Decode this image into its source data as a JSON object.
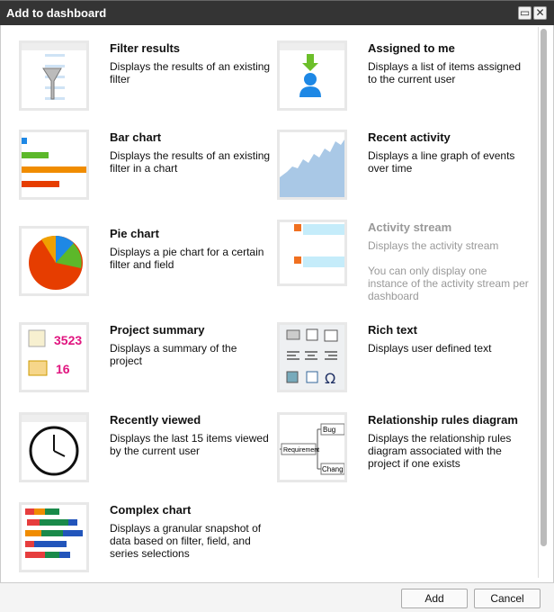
{
  "dialog": {
    "title": "Add to dashboard",
    "maximize_icon": "maximize-icon",
    "close_icon": "close-icon"
  },
  "items": [
    {
      "name": "Filter results",
      "desc": "Displays the results of an existing filter",
      "icon": "funnel-icon"
    },
    {
      "name": "Assigned to me",
      "desc": "Displays a list of items assigned to the current user",
      "icon": "user-assign-icon"
    },
    {
      "name": "Bar chart",
      "desc": "Displays the results of an existing filter in a chart",
      "icon": "bar-chart-icon"
    },
    {
      "name": "Recent activity",
      "desc": "Displays a line graph of events over time",
      "icon": "line-graph-icon"
    },
    {
      "name": "Pie chart",
      "desc": "Displays a pie chart for a certain filter and field",
      "icon": "pie-chart-icon"
    },
    {
      "name": "Activity stream",
      "desc": "Displays the activity stream",
      "note": "You can only display one instance of the activity stream per dashboard",
      "icon": "activity-stream-icon",
      "disabled": true
    },
    {
      "name": "Project summary",
      "desc": "Displays a summary of the project",
      "icon": "project-summary-icon",
      "stats": [
        "3523",
        "16"
      ]
    },
    {
      "name": "Rich text",
      "desc": "Displays user defined text",
      "icon": "rich-text-icon"
    },
    {
      "name": "Recently viewed",
      "desc": "Displays the last 15 items viewed by the current user",
      "icon": "clock-icon"
    },
    {
      "name": "Relationship rules diagram",
      "desc": "Displays the relationship rules diagram associated with the project if one exists",
      "icon": "diagram-icon",
      "diagram_labels": [
        "Requirement",
        "Bug",
        "Chang"
      ]
    },
    {
      "name": "Complex chart",
      "desc": "Displays a granular snapshot of data based on filter, field, and series selections",
      "icon": "complex-chart-icon"
    }
  ],
  "footer": {
    "add": "Add",
    "cancel": "Cancel"
  },
  "colors": {
    "titlebar": "#343434",
    "stat": "#e0157f"
  }
}
